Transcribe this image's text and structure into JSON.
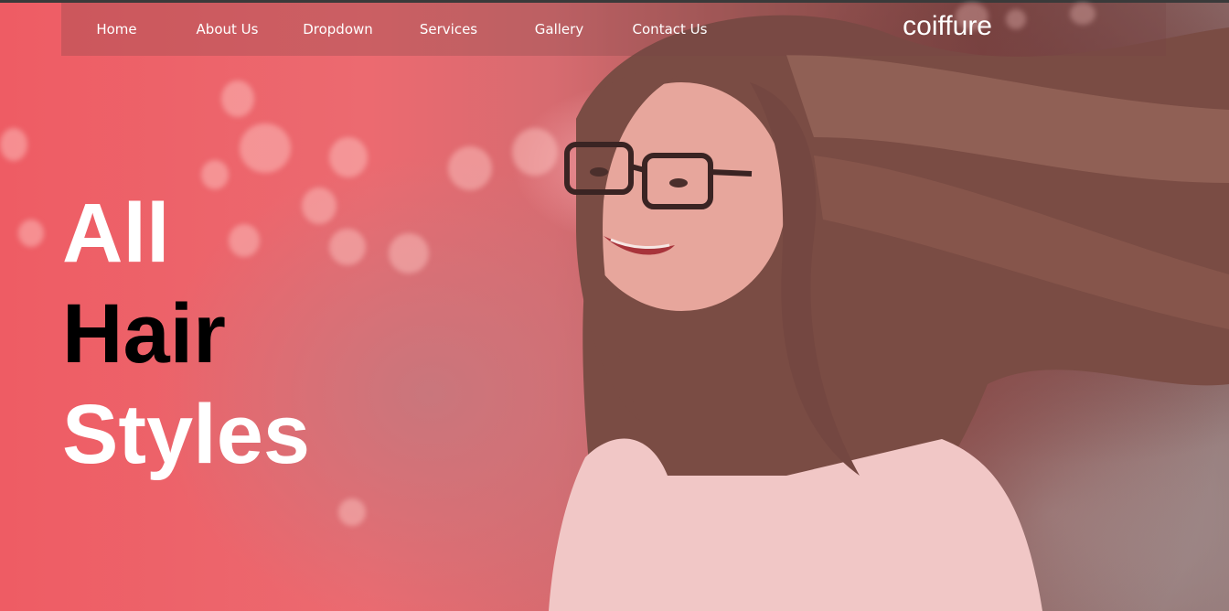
{
  "nav": {
    "items": [
      {
        "label": "Home"
      },
      {
        "label": "About Us"
      },
      {
        "label": "Dropdown"
      },
      {
        "label": "Services"
      },
      {
        "label": "Gallery"
      },
      {
        "label": "Contact Us"
      }
    ],
    "brand": "coiffure"
  },
  "hero": {
    "line1": "All",
    "line2": "Hair",
    "line3": "Styles",
    "colors": {
      "line1": "#ffffff",
      "line2": "#000000",
      "line3": "#ffffff",
      "overlay": "#ee5c64"
    }
  }
}
